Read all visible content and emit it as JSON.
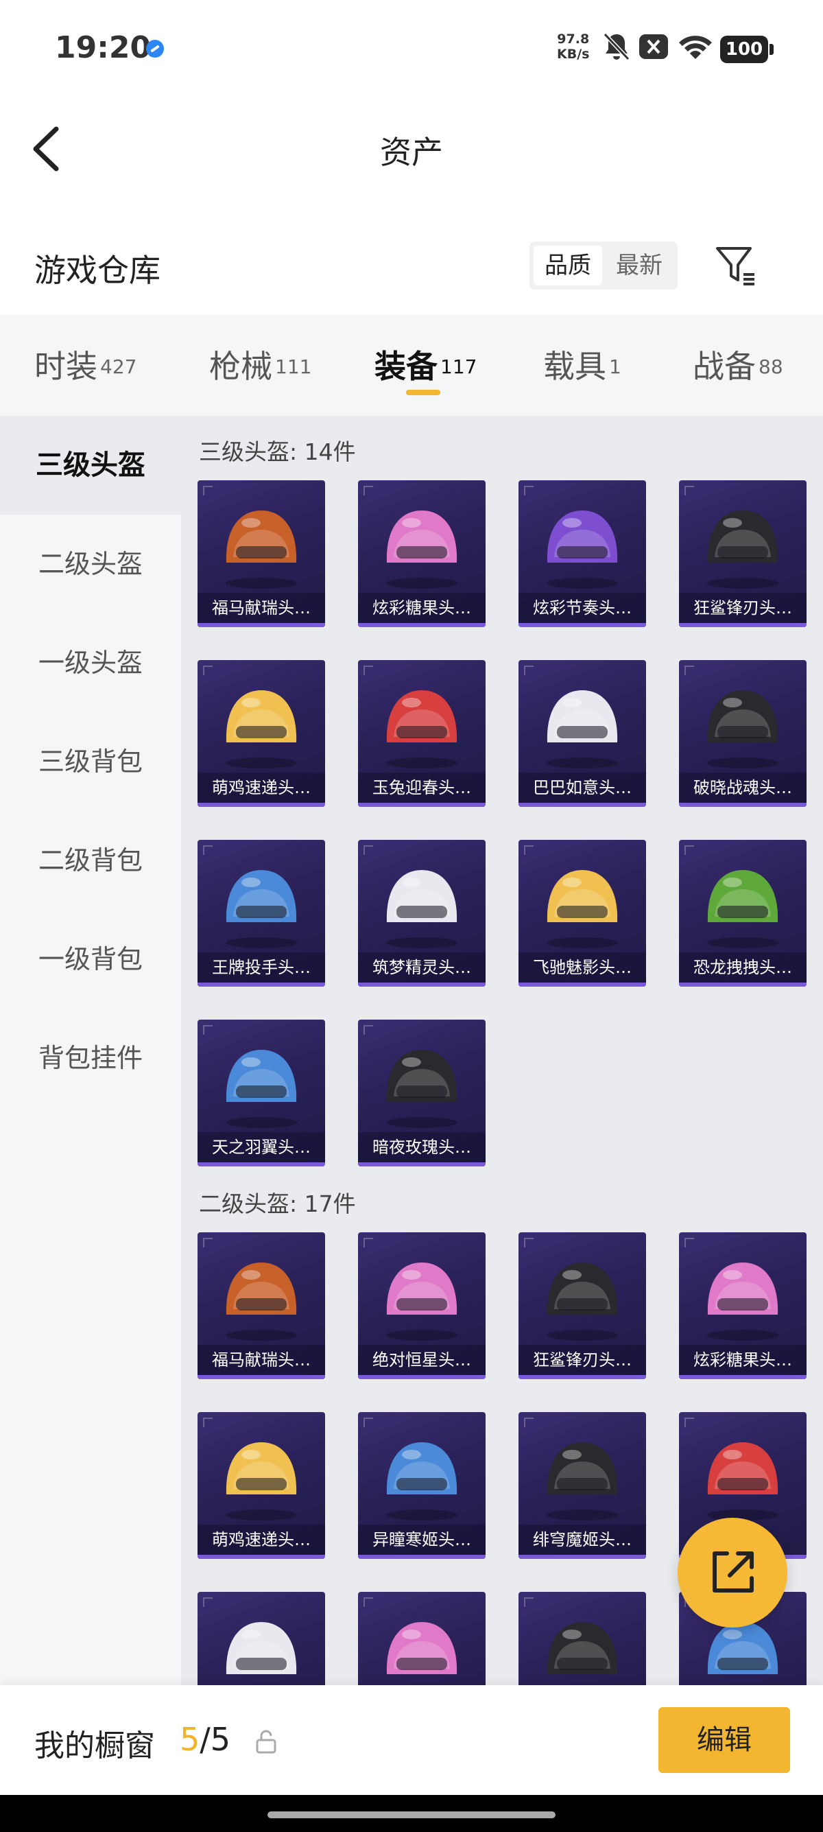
{
  "status_bar": {
    "time": "19:20",
    "network_speed_value": "97.8",
    "network_speed_unit": "KB/s",
    "battery": "100",
    "icons": [
      "browser-icon",
      "mute-icon",
      "close-box-icon",
      "wifi-icon",
      "battery-icon"
    ]
  },
  "header": {
    "title": "资产",
    "back_icon": "back-chevron-icon"
  },
  "warehouse": {
    "title": "游戏仓库",
    "sort_options": [
      "品质",
      "最新"
    ],
    "selected_sort": "品质",
    "filter_icon": "filter-icon"
  },
  "tabs": [
    {
      "label": "时装",
      "count": "427"
    },
    {
      "label": "枪械",
      "count": "111"
    },
    {
      "label": "装备",
      "count": "117"
    },
    {
      "label": "载具",
      "count": "1"
    },
    {
      "label": "战备",
      "count": "88"
    }
  ],
  "active_tab": "装备",
  "sidebar": {
    "items": [
      "三级头盔",
      "二级头盔",
      "一级头盔",
      "三级背包",
      "二级背包",
      "一级背包",
      "背包挂件"
    ],
    "active": "三级头盔"
  },
  "groups": [
    {
      "title": "三级头盔: 14件",
      "items": [
        "福马献瑞头…",
        "炫彩糖果头…",
        "炫彩节奏头…",
        "狂鲨锋刃头…",
        "萌鸡速递头…",
        "玉兔迎春头…",
        "巴巴如意头…",
        "破晓战魂头…",
        "王牌投手头…",
        "筑梦精灵头…",
        "飞驰魅影头…",
        "恐龙拽拽头…",
        "天之羽翼头…",
        "暗夜玫瑰头…"
      ]
    },
    {
      "title": "二级头盔: 17件",
      "items": [
        "福马献瑞头…",
        "绝对恒星头…",
        "狂鲨锋刃头…",
        "炫彩糖果头…",
        "萌鸡速递头…",
        "异瞳寒姬头…",
        "绯穹魔姬头…",
        "",
        "",
        "",
        "",
        ""
      ]
    }
  ],
  "item_colors": {
    "orange": "#c8602a",
    "pink": "#e07ac8",
    "purple": "#7d4fd0",
    "black": "#2a2a2e",
    "yellow": "#f0c050",
    "red_white": "#d84040",
    "white": "#e8e8ee",
    "green": "#5fa83a",
    "blue": "#4a8ad8"
  },
  "bottom_bar": {
    "label": "我的橱窗",
    "current": "5",
    "total": "/5",
    "lock_icon": "unlock-icon",
    "edit_label": "编辑"
  },
  "fab_icon": "share-external-icon"
}
